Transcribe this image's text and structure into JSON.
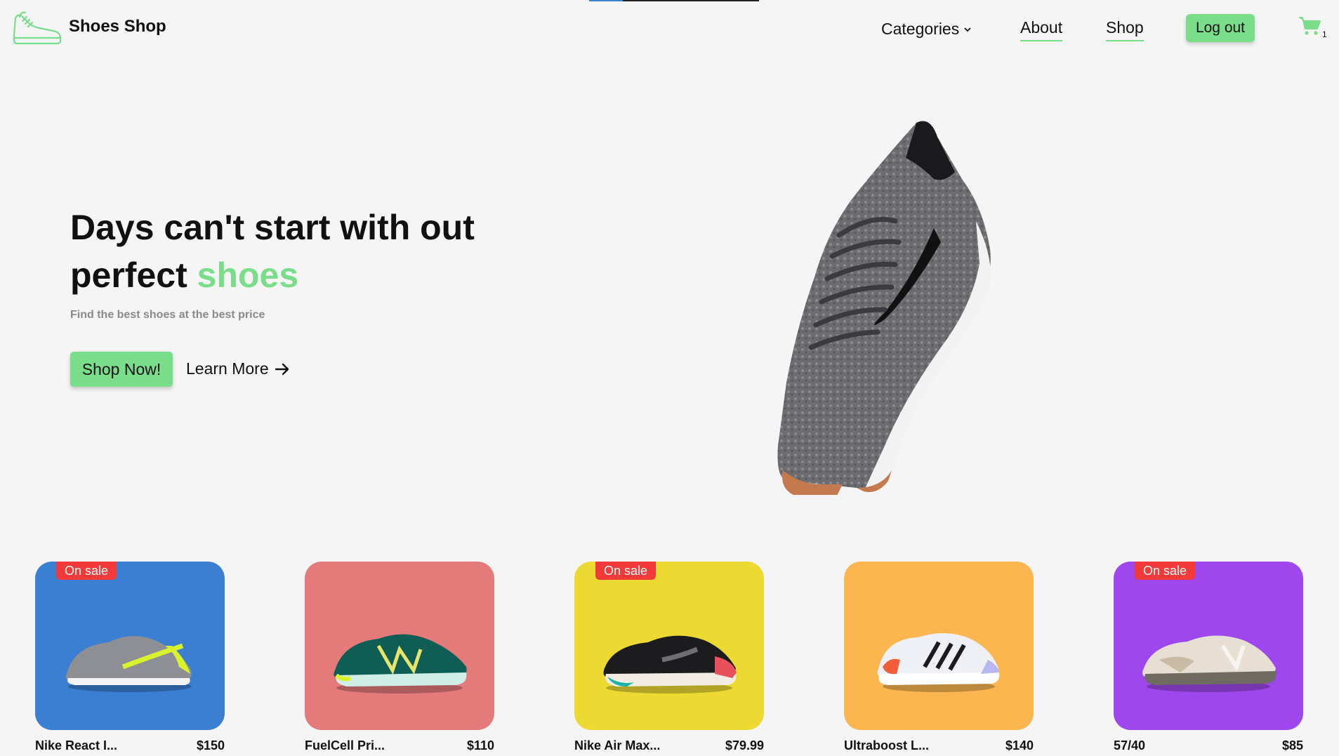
{
  "header": {
    "brand": "Shoes Shop",
    "nav": {
      "categories": "Categories",
      "about": "About",
      "shop": "Shop",
      "logout": "Log out"
    },
    "cart_count": "1"
  },
  "hero": {
    "title_line1": "Days can't start with out",
    "title_line2_prefix": "perfect",
    "title_accent": "shoes",
    "subtitle": "Find the best shoes at the best price",
    "shop_now": "Shop Now!",
    "learn_more": "Learn More"
  },
  "colors": {
    "accent": "#79dd8a",
    "sale_badge": "#f23a3a"
  },
  "products": [
    {
      "name": "Nike React I...",
      "price": "$150",
      "badge": "On sale",
      "bg": "#3b7fd3"
    },
    {
      "name": "FuelCell Pri...",
      "price": "$110",
      "badge": "",
      "bg": "#e47a7a"
    },
    {
      "name": "Nike Air Max...",
      "price": "$79.99",
      "badge": "On sale",
      "bg": "#ecda33"
    },
    {
      "name": "Ultraboost L...",
      "price": "$140",
      "badge": "",
      "bg": "#fbb650"
    },
    {
      "name": "57/40",
      "price": "$85",
      "badge": "On sale",
      "bg": "#9e47ec"
    }
  ],
  "loading_progress": 0.2
}
